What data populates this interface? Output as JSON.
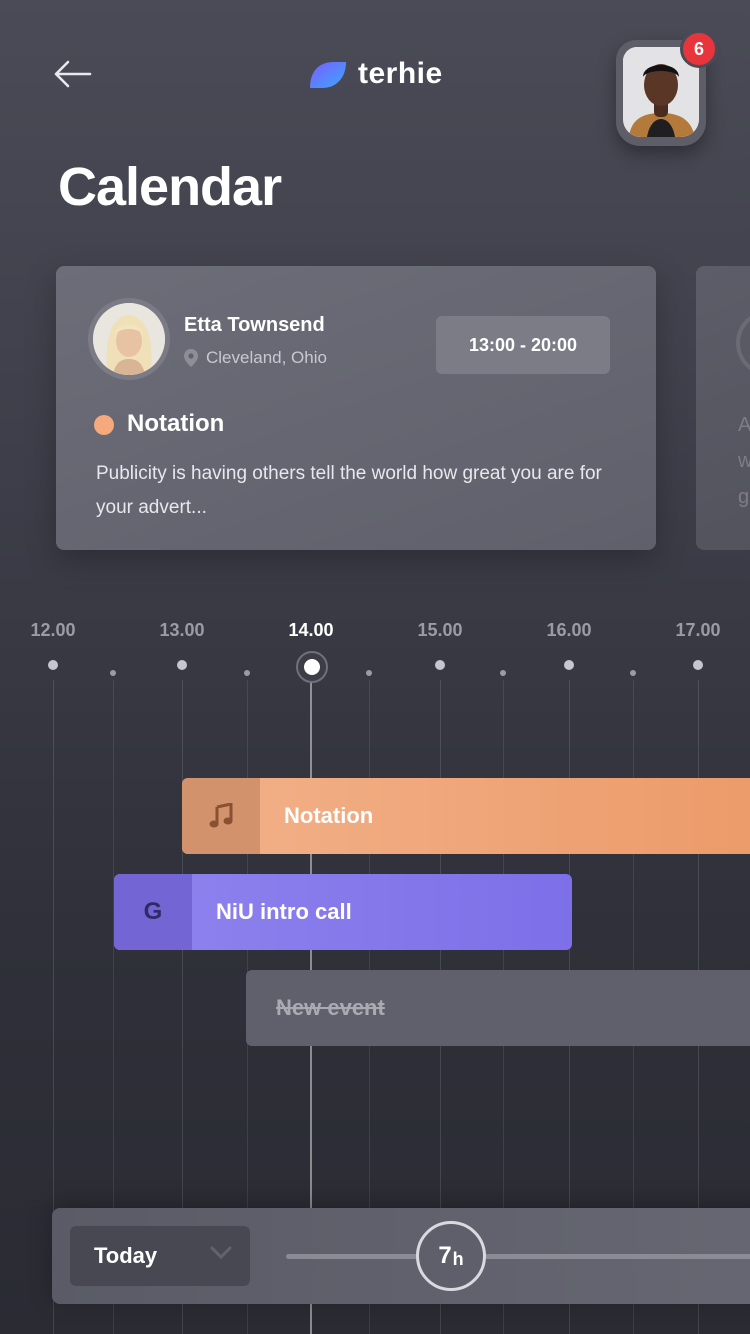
{
  "header": {
    "brand": "terhie",
    "notification_count": "6"
  },
  "page": {
    "title": "Calendar"
  },
  "event_card": {
    "person_name": "Etta Townsend",
    "location": "Cleveland, Ohio",
    "time_range": "13:00 - 20:00",
    "category": "Notation",
    "category_color": "#f5a97c",
    "description": "Publicity is having others tell the world how great you are for your advert..."
  },
  "peek_card": {
    "line1": "A",
    "line2": "w",
    "line3": "g"
  },
  "timeline": {
    "hours": [
      "12.00",
      "13.00",
      "14.00",
      "15.00",
      "16.00",
      "17.00"
    ],
    "current_hour": "14.00"
  },
  "events": [
    {
      "label": "Notation",
      "icon": "music-note-icon",
      "color": "#ee9f6e"
    },
    {
      "label": "NiU intro call",
      "icon": "google-icon",
      "icon_text": "G",
      "color": "#8579ea"
    },
    {
      "label": "New event",
      "icon": "none",
      "color": "#5f606b"
    }
  ],
  "controls": {
    "range_select": "Today",
    "duration_value": "7",
    "duration_unit": "h"
  }
}
